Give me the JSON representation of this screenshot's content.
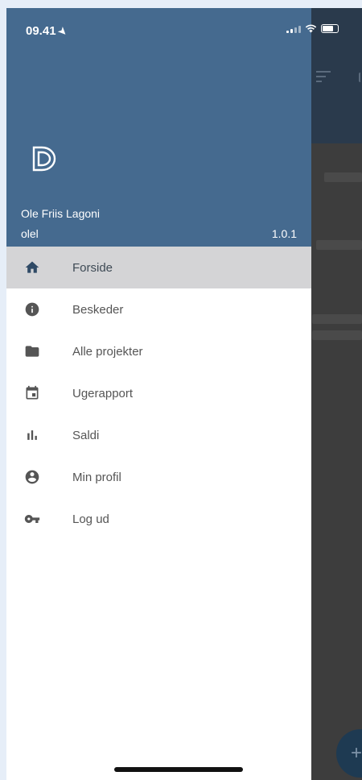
{
  "status_bar": {
    "time": "09.41"
  },
  "drawer": {
    "user_name": "Ole Friis Lagoni",
    "user_id": "olel",
    "version": "1.0.1",
    "menu": [
      {
        "label": "Forside",
        "icon": "home-icon",
        "active": true
      },
      {
        "label": "Beskeder",
        "icon": "info-icon",
        "active": false
      },
      {
        "label": "Alle projekter",
        "icon": "folder-icon",
        "active": false
      },
      {
        "label": "Ugerapport",
        "icon": "calendar-icon",
        "active": false
      },
      {
        "label": "Saldi",
        "icon": "bar-chart-icon",
        "active": false
      },
      {
        "label": "Min profil",
        "icon": "account-icon",
        "active": false
      },
      {
        "label": "Log ud",
        "icon": "key-icon",
        "active": false
      }
    ]
  },
  "colors": {
    "drawer_header": "#456a8f",
    "active_item": "#d4d4d6",
    "icon": "#555555"
  }
}
